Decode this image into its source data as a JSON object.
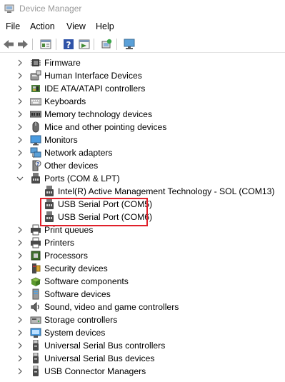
{
  "window": {
    "title": "Device Manager"
  },
  "menu": [
    "File",
    "Action",
    "View",
    "Help"
  ],
  "toolbar": {
    "buttons": [
      "back-icon",
      "forward-icon",
      "properties-icon",
      "help-icon",
      "show-hidden-icon",
      "scan-hardware-icon",
      "monitor-icon"
    ]
  },
  "tree": [
    {
      "label": "Firmware",
      "icon": "firmware-icon",
      "expanded": false
    },
    {
      "label": "Human Interface Devices",
      "icon": "hid-icon",
      "expanded": false
    },
    {
      "label": "IDE ATA/ATAPI controllers",
      "icon": "ide-icon",
      "expanded": false
    },
    {
      "label": "Keyboards",
      "icon": "keyboard-icon",
      "expanded": false
    },
    {
      "label": "Memory technology devices",
      "icon": "memory-icon",
      "expanded": false
    },
    {
      "label": "Mice and other pointing devices",
      "icon": "mouse-icon",
      "expanded": false
    },
    {
      "label": "Monitors",
      "icon": "monitor-icon",
      "expanded": false
    },
    {
      "label": "Network adapters",
      "icon": "network-icon",
      "expanded": false
    },
    {
      "label": "Other devices",
      "icon": "other-devices-icon",
      "expanded": false
    },
    {
      "label": "Ports (COM & LPT)",
      "icon": "port-icon",
      "expanded": true,
      "children": [
        {
          "label": "Intel(R) Active Management Technology - SOL (COM13)",
          "icon": "port-icon"
        },
        {
          "label": "USB Serial Port (COM5)",
          "icon": "port-icon"
        },
        {
          "label": "USB Serial Port (COM6)",
          "icon": "port-icon"
        }
      ]
    },
    {
      "label": "Print queues",
      "icon": "printer-icon",
      "expanded": false
    },
    {
      "label": "Printers",
      "icon": "printer-icon",
      "expanded": false
    },
    {
      "label": "Processors",
      "icon": "processor-icon",
      "expanded": false
    },
    {
      "label": "Security devices",
      "icon": "security-icon",
      "expanded": false
    },
    {
      "label": "Software components",
      "icon": "software-icon",
      "expanded": false
    },
    {
      "label": "Software devices",
      "icon": "software-device-icon",
      "expanded": false
    },
    {
      "label": "Sound, video and game controllers",
      "icon": "sound-icon",
      "expanded": false
    },
    {
      "label": "Storage controllers",
      "icon": "storage-icon",
      "expanded": false
    },
    {
      "label": "System devices",
      "icon": "system-icon",
      "expanded": false
    },
    {
      "label": "Universal Serial Bus controllers",
      "icon": "usb-icon",
      "expanded": false
    },
    {
      "label": "Universal Serial Bus devices",
      "icon": "usb-icon",
      "expanded": false
    },
    {
      "label": "USB Connector Managers",
      "icon": "usb-connector-icon",
      "expanded": false
    }
  ],
  "highlight_color": "#e0202a"
}
